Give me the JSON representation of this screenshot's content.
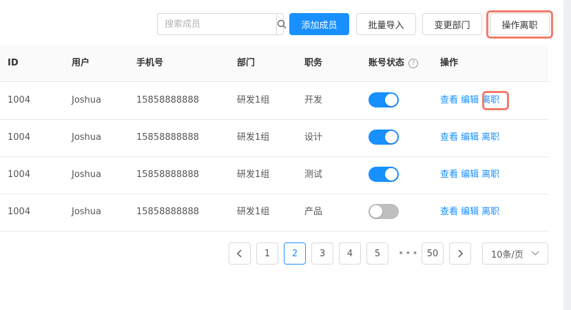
{
  "toolbar": {
    "search_placeholder": "搜索成员",
    "add_member": "添加成员",
    "batch_import": "批量导入",
    "change_dept": "变更部门",
    "resign_op": "操作离职"
  },
  "table": {
    "columns": [
      "ID",
      "用户",
      "手机号",
      "部门",
      "职务",
      "账号状态",
      "操作"
    ],
    "actions": {
      "view": "查看",
      "edit": "编辑",
      "resign": "离职"
    },
    "rows": [
      {
        "id": "1004",
        "user": "Joshua",
        "phone": "15858888888",
        "dept": "研发1组",
        "title": "开发",
        "enabled": true
      },
      {
        "id": "1004",
        "user": "Joshua",
        "phone": "15858888888",
        "dept": "研发1组",
        "title": "设计",
        "enabled": true
      },
      {
        "id": "1004",
        "user": "Joshua",
        "phone": "15858888888",
        "dept": "研发1组",
        "title": "测试",
        "enabled": true
      },
      {
        "id": "1004",
        "user": "Joshua",
        "phone": "15858888888",
        "dept": "研发1组",
        "title": "产品",
        "enabled": false
      }
    ]
  },
  "pagination": {
    "pages": [
      "1",
      "2",
      "3",
      "4",
      "5"
    ],
    "current": "2",
    "ellipsis": "•••",
    "last": "50",
    "page_size": "10条/页"
  },
  "colors": {
    "primary": "#1890ff",
    "highlight": "#f47a6a"
  }
}
